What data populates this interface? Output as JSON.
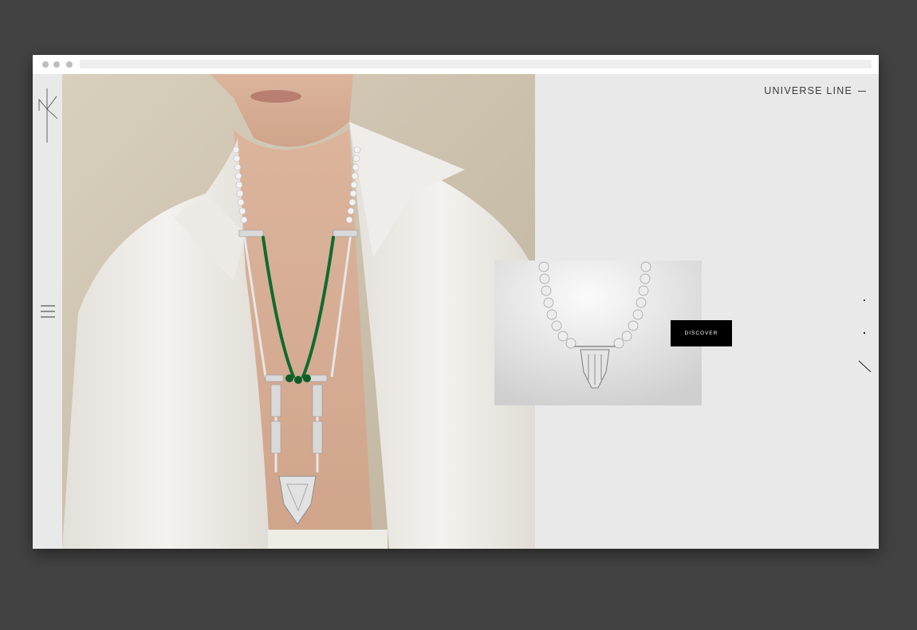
{
  "browser": {
    "address": ""
  },
  "logo": {
    "icon": "nk-monogram-icon"
  },
  "header": {
    "collection_link": "UNIVERSE LINE"
  },
  "sidebar": {
    "menu_icon": "hamburger-menu-icon"
  },
  "product": {
    "cta_label": "DISCOVER"
  },
  "slider": {
    "dots": 2,
    "next_icon": "diagonal-arrow-icon"
  },
  "colors": {
    "page_background": "#424242",
    "panel_background": "#e9e9e9",
    "button_background": "#000000",
    "button_text": "#ffffff",
    "emerald": "#0f6b2d"
  }
}
